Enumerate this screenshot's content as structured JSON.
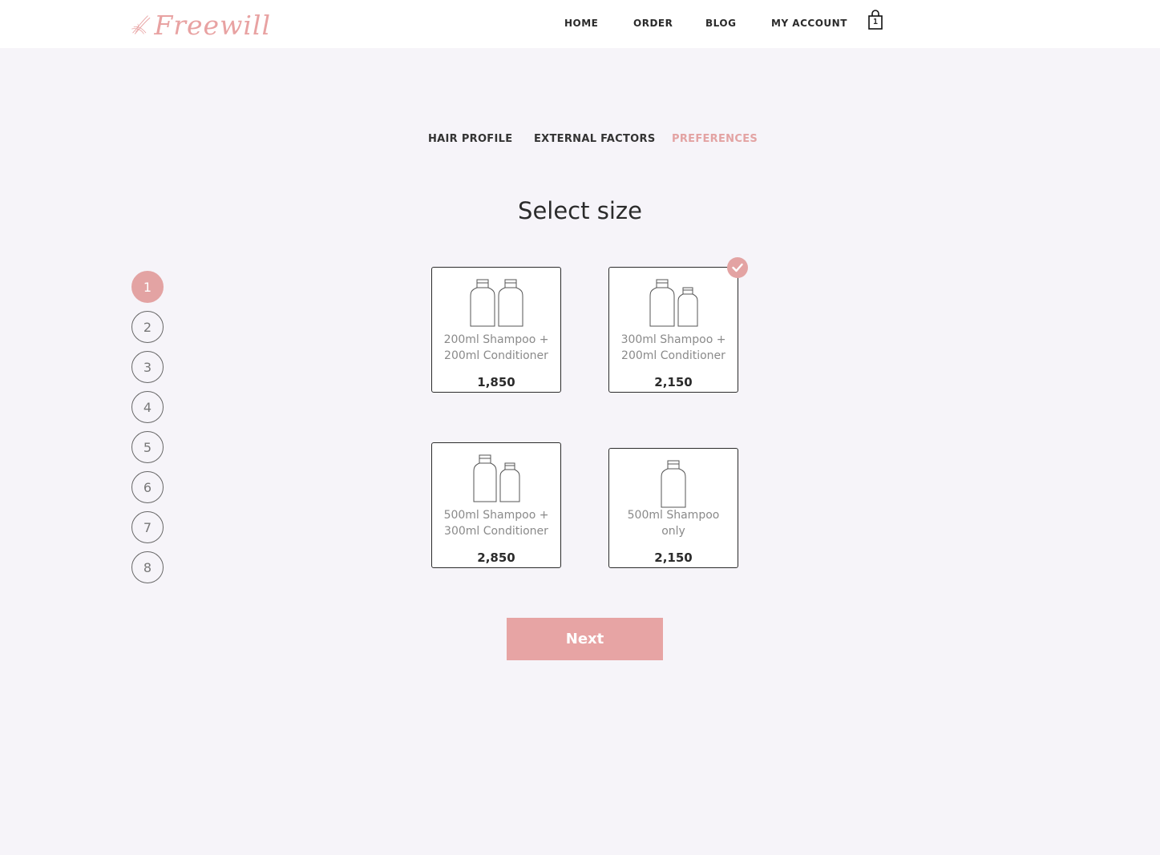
{
  "brand": {
    "name": "Freewill"
  },
  "nav": {
    "home": "HOME",
    "order": "ORDER",
    "blog": "BLOG",
    "account": "MY ACCOUNT",
    "cart_count": "1"
  },
  "tabs": [
    {
      "label": "HAIR PROFILE",
      "active": false
    },
    {
      "label": "EXTERNAL FACTORS",
      "active": false
    },
    {
      "label": "PREFERENCES",
      "active": true
    }
  ],
  "page_title": "Select size",
  "steps": [
    {
      "label": "1",
      "active": true
    },
    {
      "label": "2",
      "active": false
    },
    {
      "label": "3",
      "active": false
    },
    {
      "label": "4",
      "active": false
    },
    {
      "label": "5",
      "active": false
    },
    {
      "label": "6",
      "active": false
    },
    {
      "label": "7",
      "active": false
    },
    {
      "label": "8",
      "active": false
    }
  ],
  "options": [
    {
      "line1": "200ml Shampoo +",
      "line2": "200ml Conditioner",
      "price": "1,850",
      "selected": false,
      "icon": "two-bottles-icon"
    },
    {
      "line1": "300ml Shampoo +",
      "line2": "200ml Conditioner",
      "price": "2,150",
      "selected": true,
      "icon": "two-bottles-icon"
    },
    {
      "line1": "500ml Shampoo +",
      "line2": "300ml Conditioner",
      "price": "2,850",
      "selected": false,
      "icon": "two-bottles-icon"
    },
    {
      "line1": "500ml Shampoo",
      "line2": "only",
      "price": "2,150",
      "selected": false,
      "icon": "bottle-icon"
    }
  ],
  "next_label": "Next",
  "colors": {
    "accent": "#e3a3a3",
    "background": "#f6f4f9",
    "text": "#2b2b2b"
  }
}
